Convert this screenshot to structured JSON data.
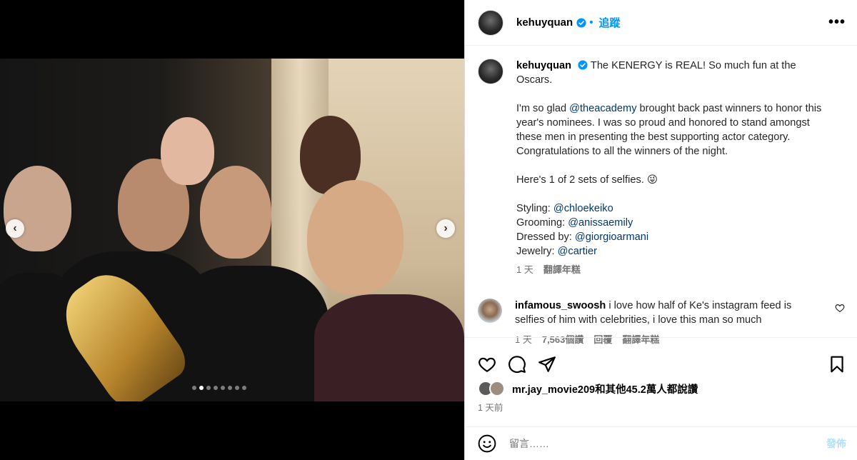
{
  "header": {
    "username": "kehuyquan",
    "follow_label": "追蹤",
    "more_label": "•••"
  },
  "carousel": {
    "prev_label": "‹",
    "next_label": "›",
    "active_index": 2,
    "total": 8
  },
  "caption": {
    "username": "kehuyquan",
    "headline": "The KENERGY is REAL! So much fun at the Oscars.",
    "p1_before": "I'm so glad ",
    "p1_mention": "@theacademy",
    "p1_after": " brought back past winners to honor this year's nominees. I was so proud and honored to stand amongst these men in presenting the best supporting actor category. Congratulations to all the winners of the night.",
    "p2": "Here's 1 of 2 sets of selfies. 😜",
    "credits": [
      {
        "label": "Styling: ",
        "mention": "@chloekeiko"
      },
      {
        "label": "Grooming: ",
        "mention": "@anissaemily"
      },
      {
        "label": "Dressed by: ",
        "mention": "@giorgioarmani"
      },
      {
        "label": "Jewelry: ",
        "mention": "@cartier"
      }
    ],
    "time": "1 天",
    "translate": "翻譯年糕"
  },
  "comment": {
    "username": "infamous_swoosh",
    "text": "i love how half of Ke's instagram feed is selfies of him with celebrities, i love this man so much",
    "time": "1 天",
    "likes": "7,563個讚",
    "reply": "回覆",
    "translate": "翻譯年糕"
  },
  "likes": {
    "text": "mr.jay_movie209和其他45.2萬人都說讚"
  },
  "post_time": "1 天前",
  "composer": {
    "placeholder": "留言……",
    "post_label": "發佈"
  },
  "colors": {
    "accent": "#0095f6",
    "mention": "#00376b",
    "muted": "#737373"
  }
}
